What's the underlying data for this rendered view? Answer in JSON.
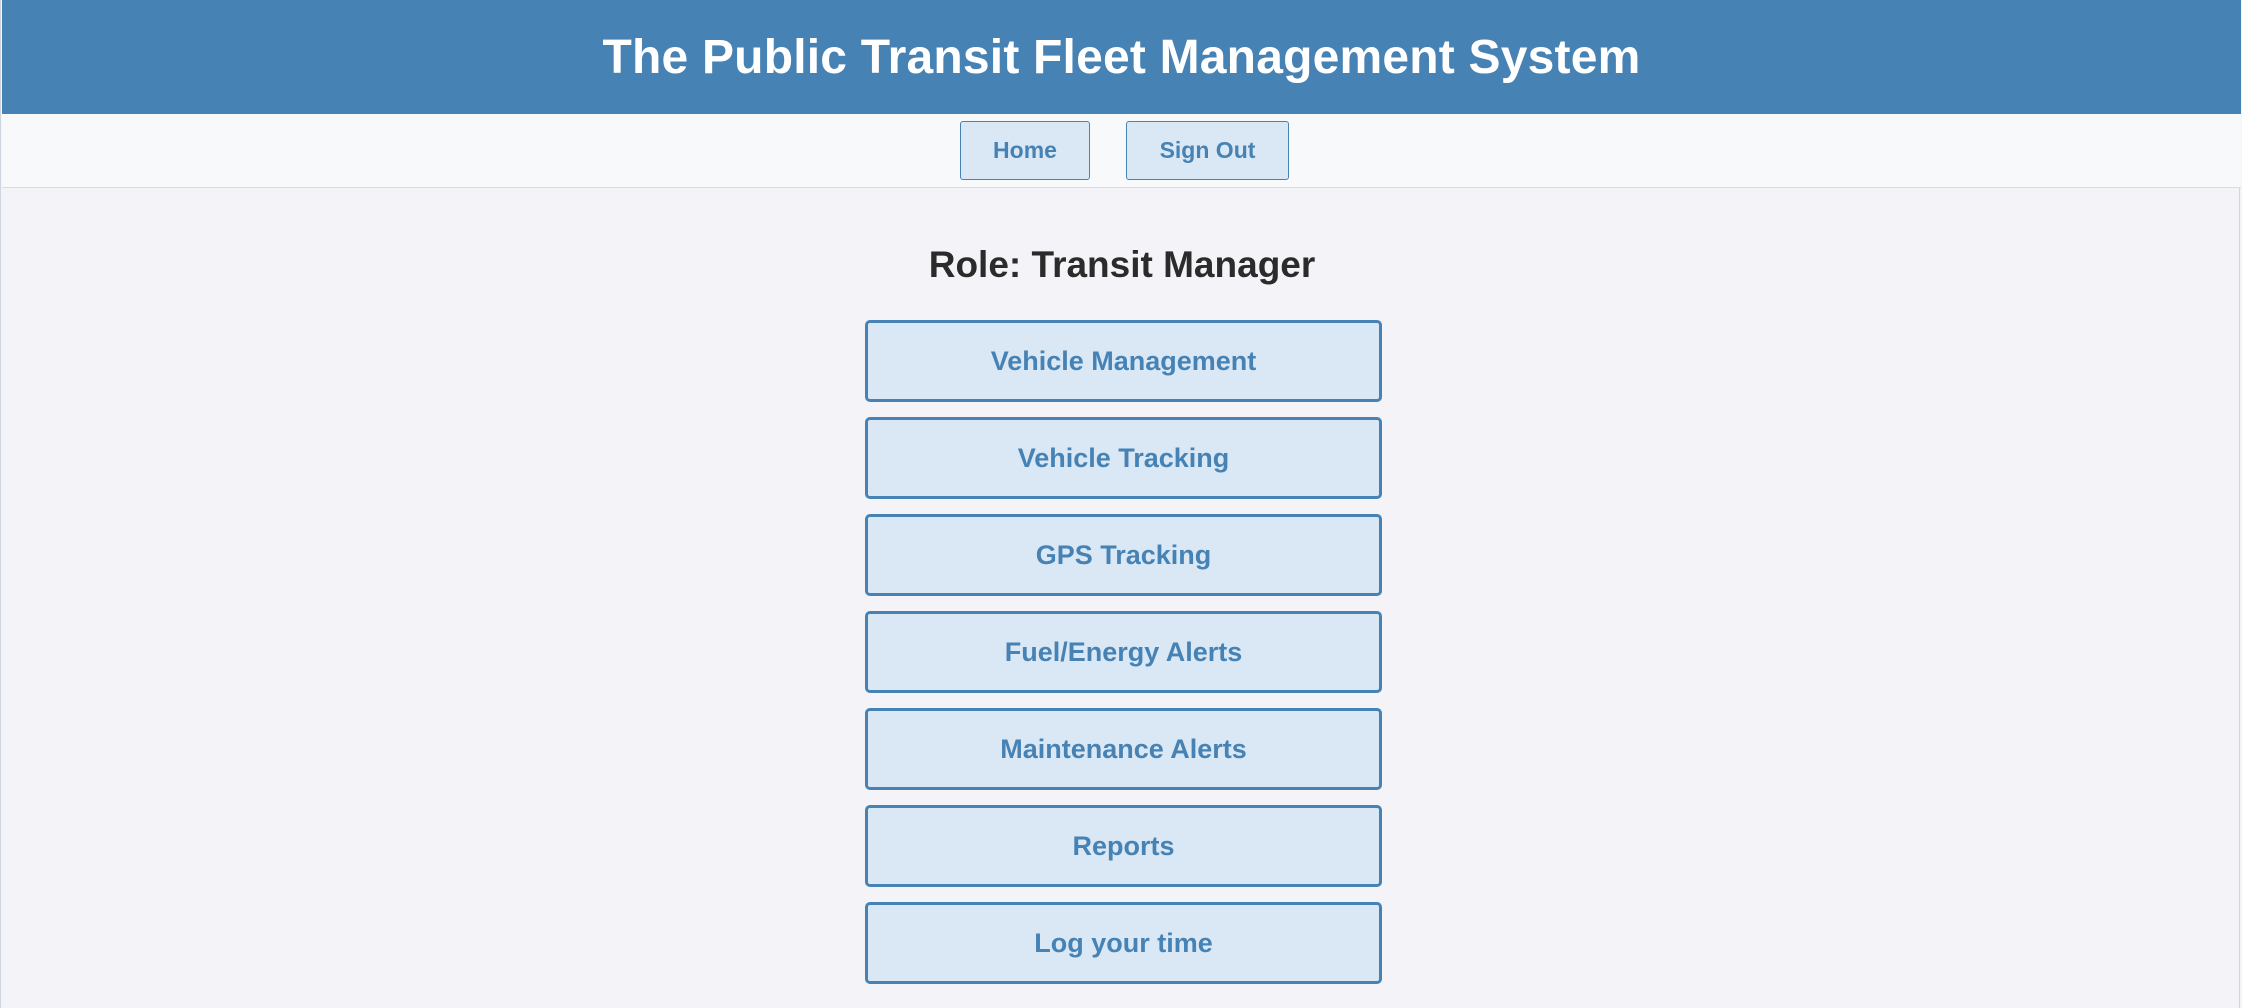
{
  "header": {
    "title": "The Public Transit Fleet Management System"
  },
  "nav": {
    "home_label": "Home",
    "signout_label": "Sign Out"
  },
  "main": {
    "role_title": "Role: Transit Manager",
    "menu_items": [
      {
        "label": "Vehicle Management"
      },
      {
        "label": "Vehicle Tracking"
      },
      {
        "label": "GPS Tracking"
      },
      {
        "label": "Fuel/Energy Alerts"
      },
      {
        "label": "Maintenance Alerts"
      },
      {
        "label": "Reports"
      },
      {
        "label": "Log your time"
      }
    ]
  },
  "colors": {
    "header_bg": "#4682b4",
    "button_bg": "#dae8f5",
    "button_text": "#4682b4",
    "page_bg": "#f3f3f8"
  }
}
